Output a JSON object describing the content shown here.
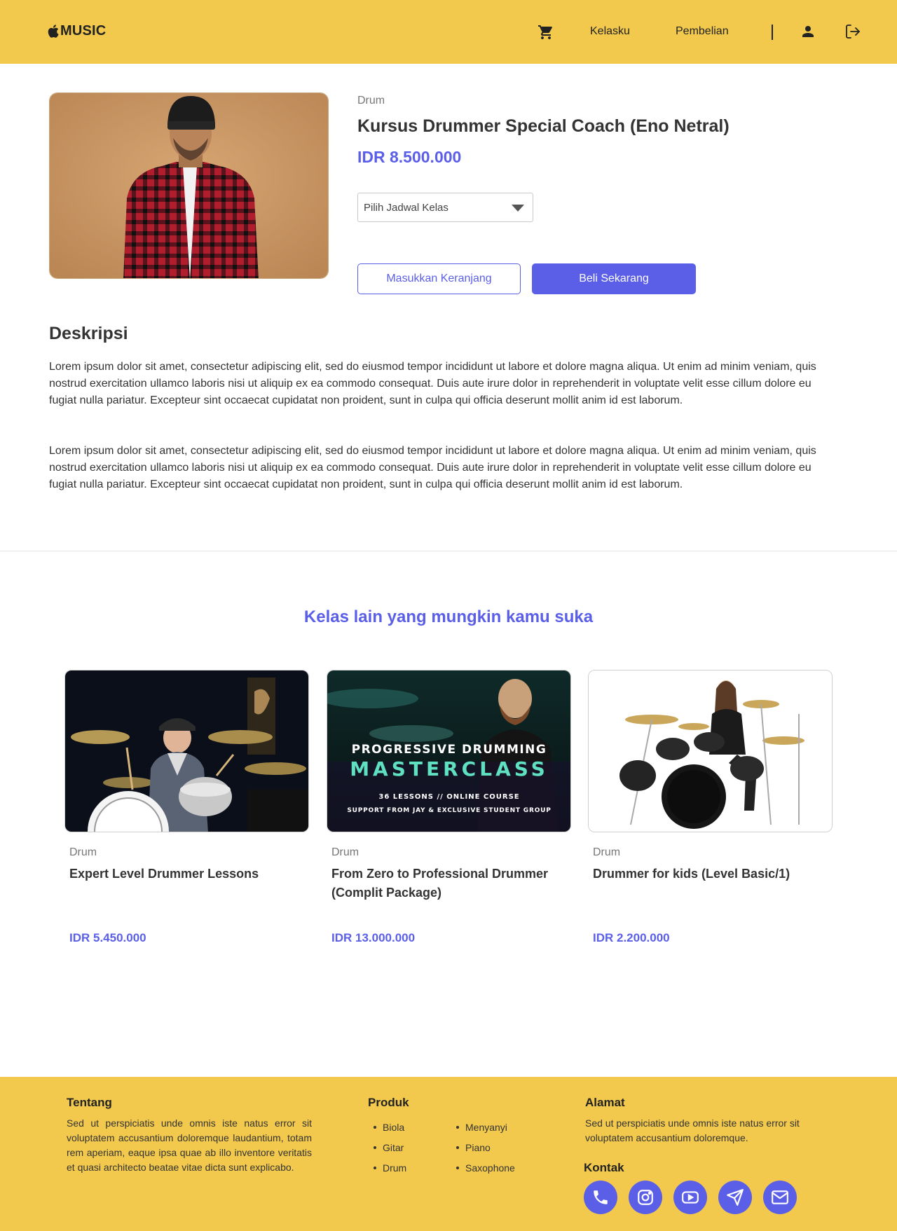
{
  "header": {
    "logo_text": "MUSIC",
    "nav": {
      "kelasku": "Kelasku",
      "pembelian": "Pembelian"
    },
    "icons": [
      "cart-icon",
      "user-icon",
      "logout-icon"
    ]
  },
  "product": {
    "category": "Drum",
    "title": "Kursus Drummer Special Coach (Eno Netral)",
    "price": "IDR 8.500.000",
    "schedule_select": {
      "selected": "Pilih Jadwal Kelas"
    },
    "buttons": {
      "add_to_cart": "Masukkan Keranjang",
      "buy_now": "Beli Sekarang"
    }
  },
  "description": {
    "heading": "Deskripsi",
    "paragraphs": [
      "Lorem ipsum dolor sit amet, consectetur adipiscing elit, sed do eiusmod tempor incididunt ut labore et dolore magna aliqua. Ut enim ad minim veniam, quis nostrud exercitation ullamco laboris nisi ut aliquip ex ea commodo consequat. Duis aute irure dolor in reprehenderit in voluptate velit esse cillum dolore eu fugiat nulla pariatur. Excepteur sint occaecat cupidatat non proident, sunt in culpa qui officia deserunt mollit anim id est laborum.",
      "Lorem ipsum dolor sit amet, consectetur adipiscing elit, sed do eiusmod tempor incididunt ut labore et dolore magna aliqua. Ut enim ad minim veniam, quis nostrud exercitation ullamco laboris nisi ut aliquip ex ea commodo consequat. Duis aute irure dolor in reprehenderit in voluptate velit esse cillum dolore eu fugiat nulla pariatur. Excepteur sint occaecat cupidatat non proident, sunt in culpa qui officia deserunt mollit anim id est laborum."
    ]
  },
  "recommendations": {
    "heading": "Kelas lain yang mungkin kamu suka",
    "cards": [
      {
        "category": "Drum",
        "title": "Expert Level Drummer Lessons",
        "price": "IDR 5.450.000"
      },
      {
        "category": "Drum",
        "title": "From Zero to Professional Drummer (Complit Package)",
        "price": "IDR 13.000.000",
        "image_text": {
          "line1": "PROGRESSIVE DRUMMING",
          "line2": "MASTERCLASS",
          "line3": "36 LESSONS // ONLINE COURSE",
          "line4": "SUPPORT FROM JAY & EXCLUSIVE STUDENT GROUP"
        }
      },
      {
        "category": "Drum",
        "title": "Drummer for kids (Level Basic/1)",
        "price": "IDR 2.200.000"
      }
    ]
  },
  "footer": {
    "tentang": {
      "title": "Tentang",
      "text": "Sed ut perspiciatis unde omnis iste natus error sit voluptatem accusantium doloremque laudantium, totam rem aperiam, eaque ipsa quae ab illo inventore veritatis et quasi architecto beatae vitae dicta sunt explicabo."
    },
    "produk": {
      "title": "Produk",
      "col1": [
        "Biola",
        "Gitar",
        "Drum"
      ],
      "col2": [
        "Menyanyi",
        "Piano",
        "Saxophone"
      ]
    },
    "alamat": {
      "title": "Alamat",
      "text": "Sed ut perspiciatis unde omnis iste natus error sit voluptatem accusantium doloremque."
    },
    "kontak": {
      "title": "Kontak",
      "icons": [
        "phone-icon",
        "instagram-icon",
        "youtube-icon",
        "telegram-icon",
        "mail-icon"
      ]
    }
  },
  "colors": {
    "brand_yellow": "#F2C94C",
    "accent_purple": "#5B5FE8",
    "text_dark": "#333333",
    "text_muted": "#777777"
  }
}
